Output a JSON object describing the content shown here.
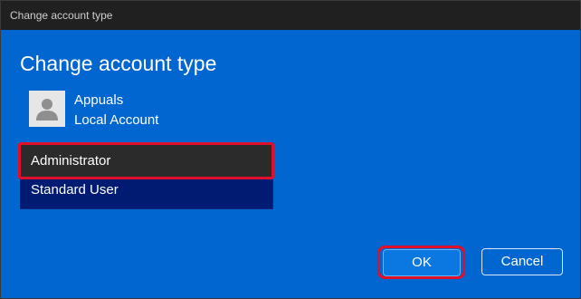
{
  "window": {
    "title": "Change account type"
  },
  "dialog": {
    "heading": "Change account type"
  },
  "account": {
    "avatar_icon": "person-icon",
    "name": "Appuals",
    "type": "Local Account"
  },
  "dropdown": {
    "selected": "Administrator",
    "options": [
      {
        "label": "Administrator",
        "highlighted": true
      },
      {
        "label": "Standard User",
        "highlighted": false
      }
    ]
  },
  "buttons": {
    "ok_label": "OK",
    "cancel_label": "Cancel"
  },
  "colors": {
    "dialog_background": "#0266d0",
    "titlebar_background": "#202020",
    "highlight_outline": "#e0102a",
    "dropdown_list_background": "#011a72",
    "selected_option_background": "#2b2b2b"
  }
}
